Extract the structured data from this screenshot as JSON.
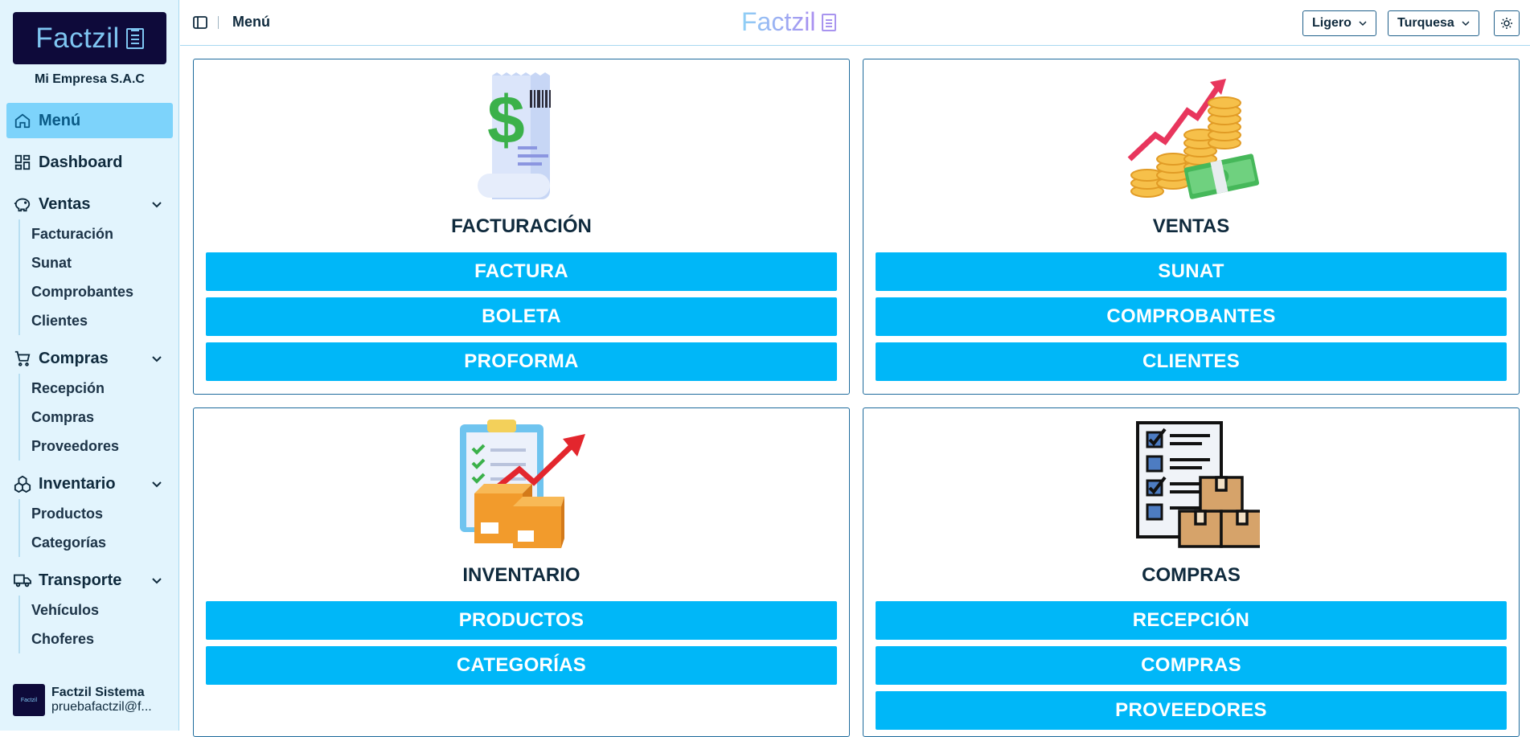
{
  "sidebar": {
    "logo_text": "Factzil",
    "company": "Mi Empresa S.A.C",
    "menu_label": "Menú",
    "dashboard_label": "Dashboard",
    "ventas": {
      "label": "Ventas",
      "items": [
        "Facturación",
        "Sunat",
        "Comprobantes",
        "Clientes"
      ]
    },
    "compras": {
      "label": "Compras",
      "items": [
        "Recepción",
        "Compras",
        "Proveedores"
      ]
    },
    "inventario": {
      "label": "Inventario",
      "items": [
        "Productos",
        "Categorías"
      ]
    },
    "transporte": {
      "label": "Transporte",
      "items": [
        "Vehículos",
        "Choferes"
      ]
    },
    "user": {
      "avatar_text": "Factzil",
      "name": "Factzil Sistema",
      "email": "pruebafactzil@f..."
    }
  },
  "header": {
    "title": "Menú",
    "logo_text": "Factzil",
    "mode_select": "Ligero",
    "theme_select": "Turquesa"
  },
  "cards": {
    "facturacion": {
      "title": "FACTURACIÓN",
      "buttons": [
        "FACTURA",
        "BOLETA",
        "PROFORMA"
      ]
    },
    "ventas": {
      "title": "VENTAS",
      "buttons": [
        "SUNAT",
        "COMPROBANTES",
        "CLIENTES"
      ]
    },
    "inventario": {
      "title": "INVENTARIO",
      "buttons": [
        "PRODUCTOS",
        "CATEGORÍAS"
      ]
    },
    "compras": {
      "title": "COMPRAS",
      "buttons": [
        "RECEPCIÓN",
        "COMPRAS",
        "PROVEEDORES"
      ]
    }
  },
  "colors": {
    "accent": "#00b7f8",
    "sidebar_bg": "#e2f4fd",
    "active_nav": "#7dd3fb",
    "logo_bg": "#0e0a3a"
  }
}
